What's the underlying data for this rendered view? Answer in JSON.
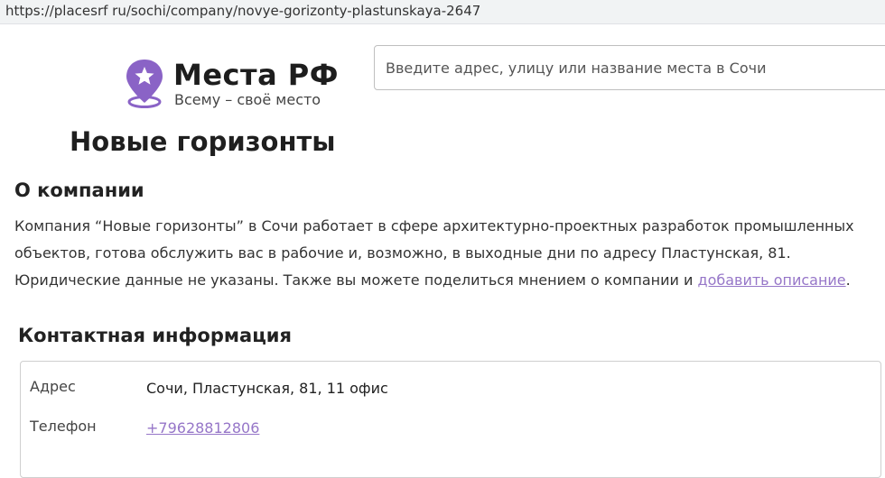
{
  "browser": {
    "url": "https://placesrf ru/sochi/company/novye-gorizonty-plastunskaya-2647"
  },
  "header": {
    "brand": "Места РФ",
    "tagline": "Всему – своё место",
    "logo_icon": "map-pin-star-icon",
    "accent_color": "#8a63c6",
    "search_placeholder": "Введите адрес, улицу или название места в Сочи"
  },
  "company": {
    "title": "Новые горизонты"
  },
  "about": {
    "heading": "О компании",
    "text_before_link": "Компания “Новые горизонты” в Сочи работает в сфере архитектурно-проектных разработок промышленных объектов, готова обслужить вас в рабочие и, возможно, в выходные дни по адресу Пластунская, 81. Юридические данные не указаны. Также вы можете поделиться мнением о компании и ",
    "link_text": "добавить описание",
    "text_after_link": "."
  },
  "contacts": {
    "heading": "Контактная информация",
    "rows": [
      {
        "label": "Адрес",
        "value": "Сочи, Пластунская, 81, 11 офис"
      },
      {
        "label": "Телефон",
        "value": "+79628812806"
      }
    ]
  }
}
